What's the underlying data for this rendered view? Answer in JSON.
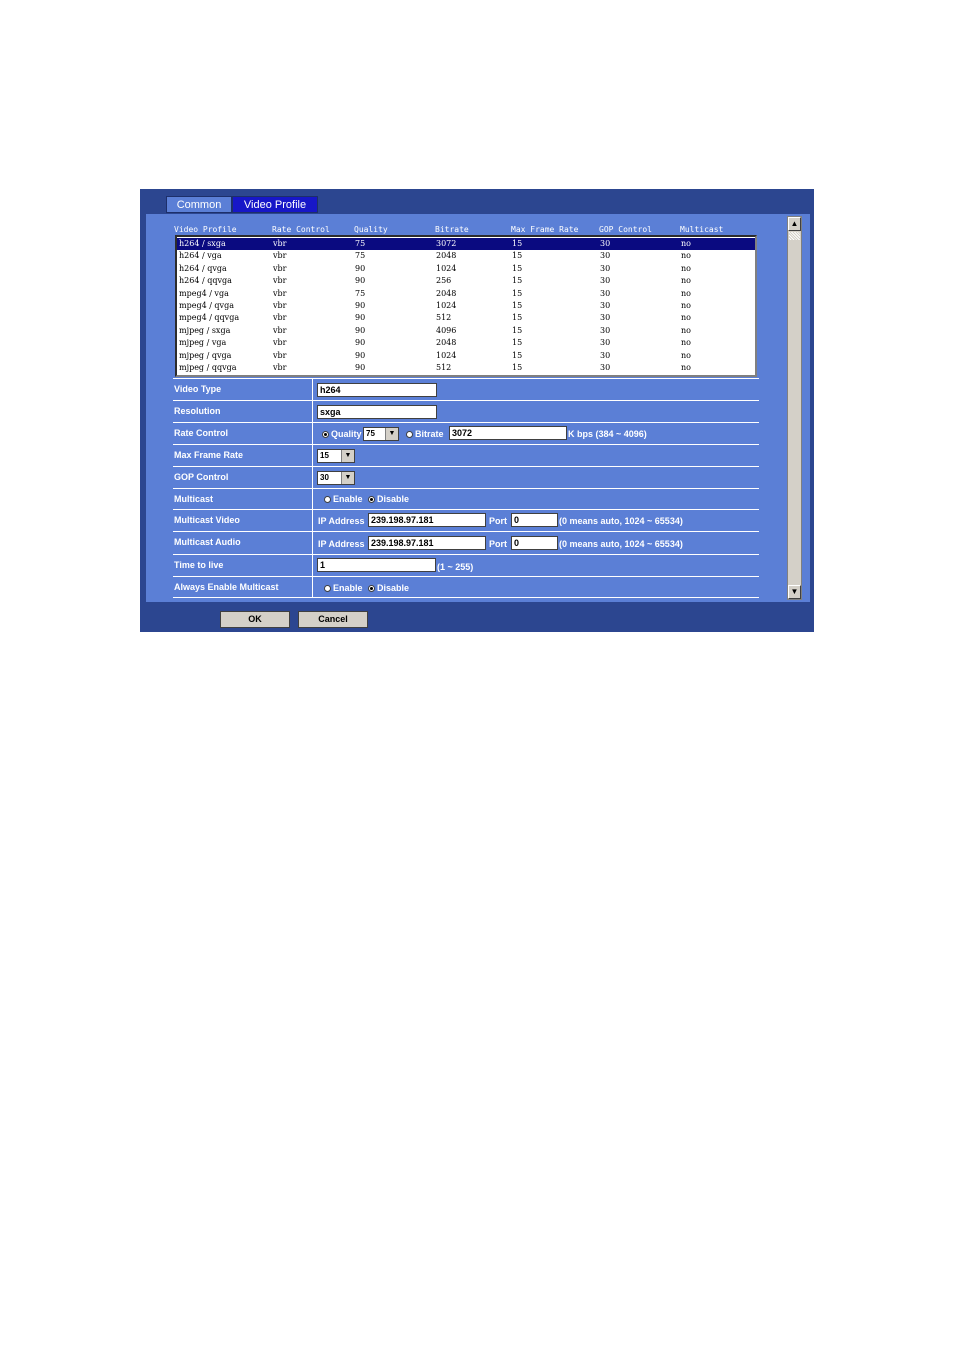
{
  "tabs": [
    {
      "label": "Common"
    },
    {
      "label": "Video Profile"
    }
  ],
  "list": {
    "headers": [
      "Video Profile",
      "Rate Control",
      "Quality",
      "Bitrate",
      "Max Frame Rate",
      "GOP Control",
      "Multicast"
    ],
    "rows": [
      [
        "h264 / sxga",
        "vbr",
        "75",
        "3072",
        "15",
        "30",
        "no"
      ],
      [
        "h264 / vga",
        "vbr",
        "75",
        "2048",
        "15",
        "30",
        "no"
      ],
      [
        "h264 / qvga",
        "vbr",
        "90",
        "1024",
        "15",
        "30",
        "no"
      ],
      [
        "h264 / qqvga",
        "vbr",
        "90",
        "256",
        "15",
        "30",
        "no"
      ],
      [
        "mpeg4 / vga",
        "vbr",
        "75",
        "2048",
        "15",
        "30",
        "no"
      ],
      [
        "mpeg4 / qvga",
        "vbr",
        "90",
        "1024",
        "15",
        "30",
        "no"
      ],
      [
        "mpeg4 / qqvga",
        "vbr",
        "90",
        "512",
        "15",
        "30",
        "no"
      ],
      [
        "mjpeg / sxga",
        "vbr",
        "90",
        "4096",
        "15",
        "30",
        "no"
      ],
      [
        "mjpeg / vga",
        "vbr",
        "90",
        "2048",
        "15",
        "30",
        "no"
      ],
      [
        "mjpeg / qvga",
        "vbr",
        "90",
        "1024",
        "15",
        "30",
        "no"
      ],
      [
        "mjpeg / qqvga",
        "vbr",
        "90",
        "512",
        "15",
        "30",
        "no"
      ]
    ]
  },
  "form": {
    "video_type": {
      "label": "Video Type",
      "value": "h264"
    },
    "resolution": {
      "label": "Resolution",
      "value": "sxga"
    },
    "rate_control": {
      "label": "Rate Control",
      "quality_label": "Quality",
      "quality_value": "75",
      "bitrate_label": "Bitrate",
      "bitrate_value": "3072",
      "bitrate_hint": "K bps (384 ~ 4096)"
    },
    "max_frame_rate": {
      "label": "Max Frame Rate",
      "value": "15"
    },
    "gop_control": {
      "label": "GOP Control",
      "value": "30"
    },
    "multicast": {
      "label": "Multicast",
      "enable": "Enable",
      "disable": "Disable"
    },
    "multicast_video": {
      "label": "Multicast Video",
      "ip_label": "IP Address",
      "ip": "239.198.97.181",
      "port_label": "Port",
      "port": "0",
      "hint": "(0 means auto, 1024 ~ 65534)"
    },
    "multicast_audio": {
      "label": "Multicast Audio",
      "ip_label": "IP Address",
      "ip": "239.198.97.181",
      "port_label": "Port",
      "port": "0",
      "hint": "(0 means auto, 1024 ~ 65534)"
    },
    "ttl": {
      "label": "Time to live",
      "value": "1",
      "hint": "(1 ~ 255)"
    },
    "always_multicast": {
      "label": "Always Enable Multicast",
      "enable": "Enable",
      "disable": "Disable"
    }
  },
  "buttons": {
    "ok": "OK",
    "cancel": "Cancel"
  },
  "icons": {
    "scroll_up": "arrow-up-icon",
    "scroll_down": "arrow-down-icon",
    "dropdown": "chevron-down-icon"
  },
  "colors": {
    "frame": "#2c4690",
    "panel": "#5b7fd6",
    "active_tab": "#1717c8",
    "selected_row": "#0a0a80"
  }
}
